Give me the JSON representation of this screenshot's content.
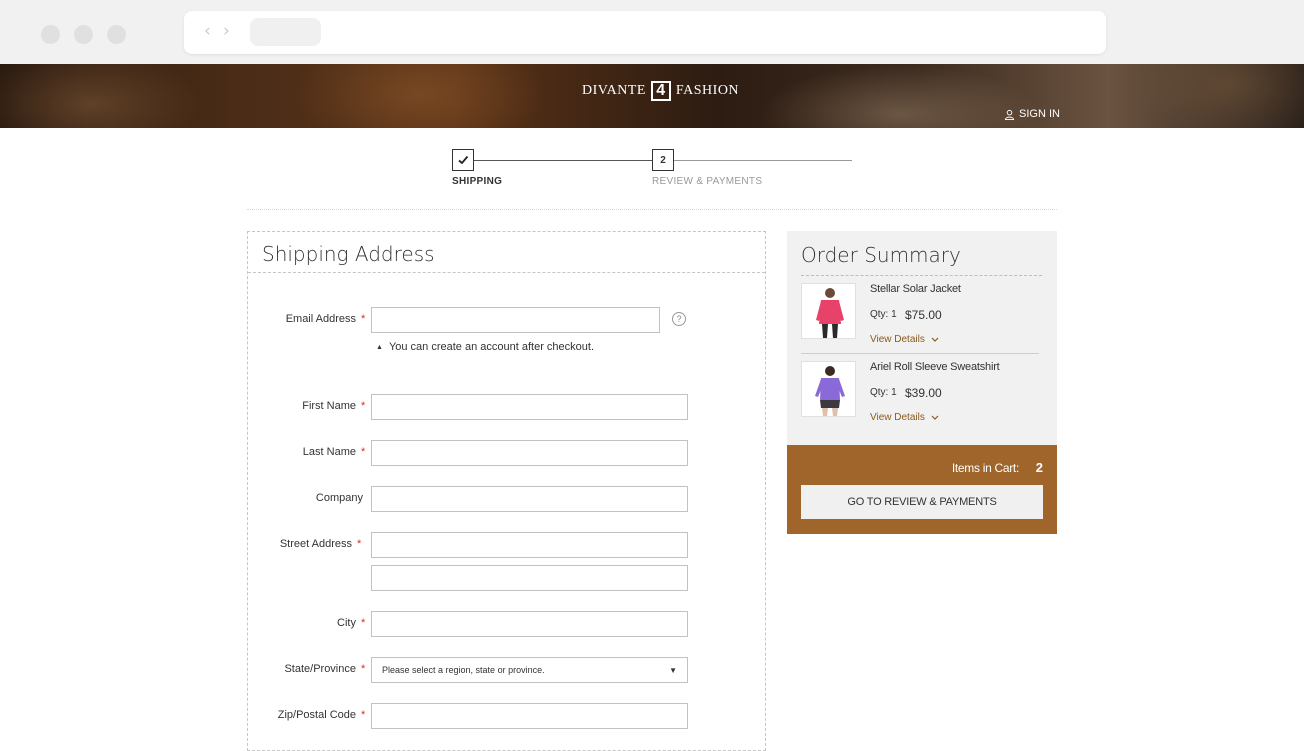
{
  "header": {
    "brand_left": "DIVANTE",
    "brand_mark": "4",
    "brand_right": "FASHION",
    "signin": "SIGN IN"
  },
  "progress": {
    "steps": [
      {
        "label": "SHIPPING",
        "state": "complete",
        "marker": "✓"
      },
      {
        "label": "REVIEW & PAYMENTS",
        "state": "pending",
        "marker": "2"
      }
    ]
  },
  "shipping": {
    "title": "Shipping Address",
    "email_label": "Email Address",
    "email_value": "",
    "email_help": "?",
    "email_note": "You can create an account after checkout.",
    "first_name_label": "First Name",
    "first_name_value": "",
    "last_name_label": "Last Name",
    "last_name_value": "",
    "company_label": "Company",
    "company_value": "",
    "street_label": "Street Address",
    "street_line1_value": "",
    "street_line2_value": "",
    "city_label": "City",
    "city_value": "",
    "state_label": "State/Province",
    "state_value": "Please select a region, state or province.",
    "zip_label": "Zip/Postal Code",
    "zip_value": "",
    "required_mark": "*"
  },
  "summary": {
    "title": "Order Summary",
    "items": [
      {
        "name": "Stellar Solar Jacket",
        "qty": "Qty: 1",
        "price": "$75.00",
        "details": "View Details",
        "color": "#e8416a"
      },
      {
        "name": "Ariel Roll Sleeve Sweatshirt",
        "qty": "Qty: 1",
        "price": "$39.00",
        "details": "View Details",
        "color": "#8a6ad8"
      }
    ],
    "items_in_cart_label": "Items in Cart:",
    "items_in_cart_count": "2",
    "cta": "GO TO REVIEW & PAYMENTS"
  },
  "colors": {
    "accent": "#a0652a",
    "required": "#e02b27",
    "link": "#8b5a1b"
  }
}
